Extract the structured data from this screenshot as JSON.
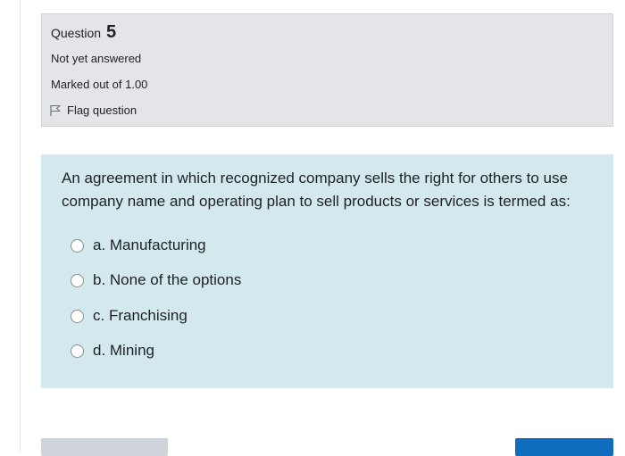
{
  "question_info": {
    "label": "Question",
    "number": "5",
    "state": "Not yet answered",
    "grade": "Marked out of 1.00",
    "flag_label": "Flag question"
  },
  "question": {
    "text": "An agreement in which recognized company sells the right for others to use company name and operating plan to sell products or services is termed as:",
    "answers": [
      {
        "label": "a. Manufacturing"
      },
      {
        "label": "b. None of the options"
      },
      {
        "label": "c. Franchising"
      },
      {
        "label": "d. Mining"
      }
    ]
  },
  "colors": {
    "info_bg": "#e3e5e8",
    "content_bg": "#d3e9ed",
    "primary_button": "#0f6cbf",
    "secondary_button": "#ced4da"
  }
}
